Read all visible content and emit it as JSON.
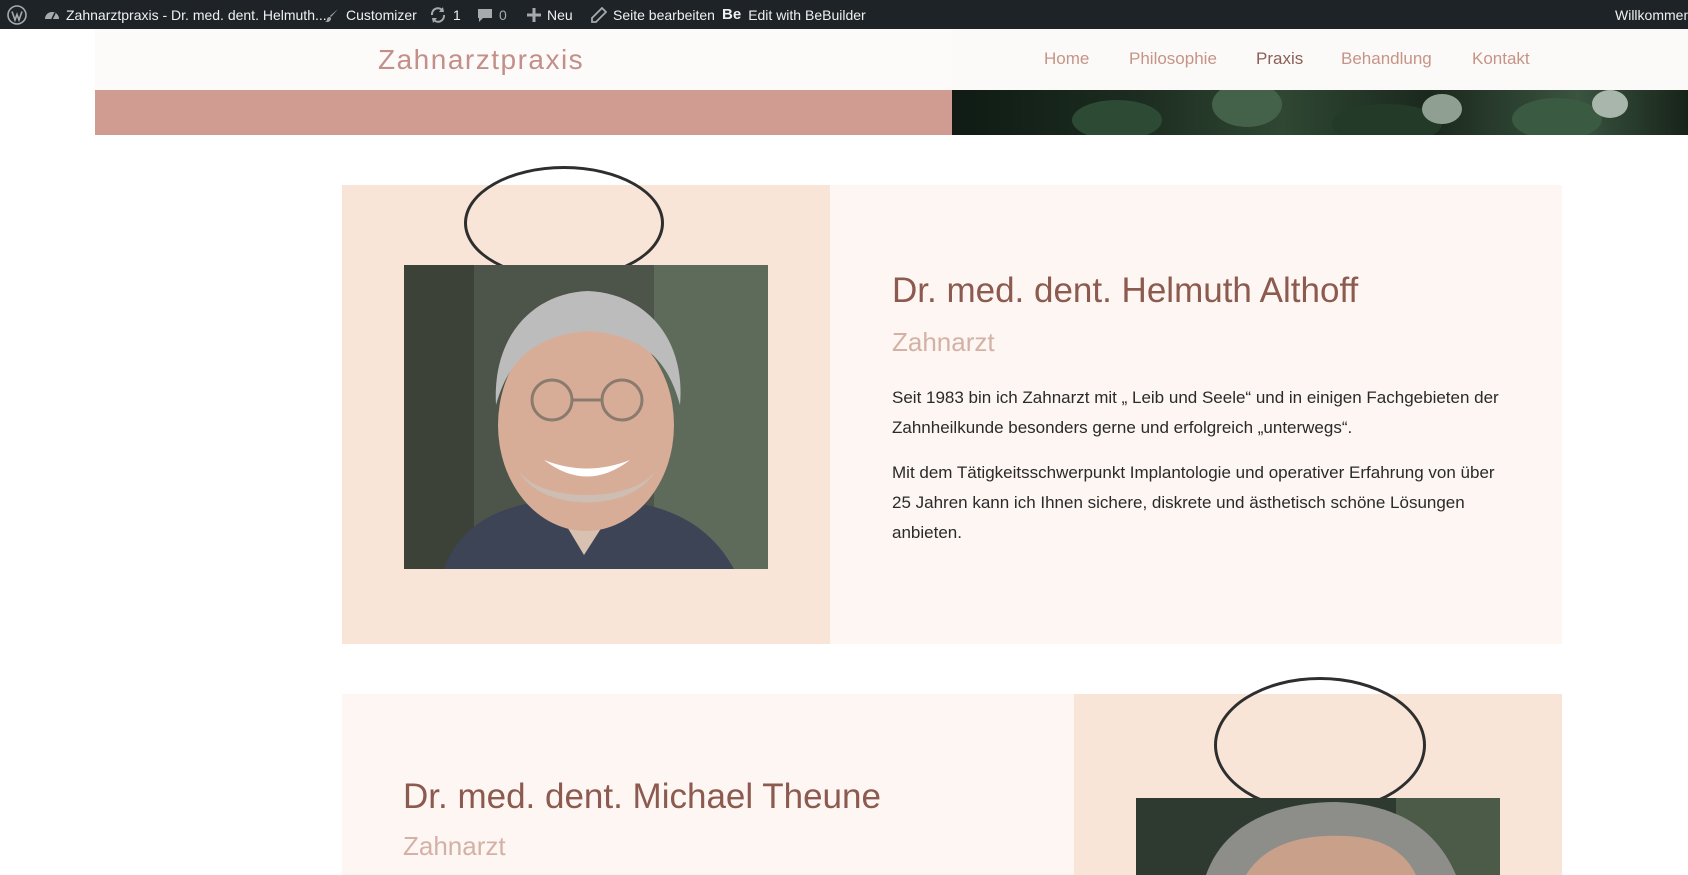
{
  "adminbar": {
    "site_title": "Zahnarztpraxis - Dr. med. dent. Helmuth...",
    "customizer": "Customizer",
    "updates_count": "1",
    "comments_count": "0",
    "new_label": "Neu",
    "edit_page": "Seite bearbeiten",
    "bebuilder_badge": "Be",
    "bebuilder": "Edit with BeBuilder",
    "welcome": "Willkommen"
  },
  "header": {
    "logo": "Zahnarztpraxis",
    "nav": [
      "Home",
      "Philosophie",
      "Praxis",
      "Behandlung",
      "Kontakt"
    ],
    "active_nav": "Praxis"
  },
  "dentists": [
    {
      "name": "Dr. med. dent. Helmuth Althoff",
      "role": "Zahnarzt",
      "paragraphs": [
        "Seit 1983 bin ich Zahnarzt mit „ Leib und Seele“ und in einigen Fachgebieten der Zahnheilkunde besonders gerne und erfolgreich „unterwegs“.",
        "Mit dem Tätigkeitsschwerpunkt Implantologie und operativer Erfahrung von über 25 Jahren kann ich Ihnen sichere, diskrete und ästhetisch schöne Lösungen anbieten."
      ]
    },
    {
      "name": "Dr. med. dent. Michael Theune",
      "role": "Zahnarzt"
    }
  ],
  "colors": {
    "adminbar_bg": "#1d2327",
    "brand_pink": "#d09b91",
    "name_brown": "#8c5a4e",
    "role_pink": "#d4b1a6",
    "panel_peach": "#f9e5d8",
    "panel_cream": "#fdf6f2"
  },
  "icons": {
    "wordpress": "wordpress-logo-icon",
    "customizer": "paintbrush-icon",
    "updates": "refresh-icon",
    "comments": "comment-bubble-icon",
    "new": "plus-icon",
    "edit": "pencil-icon"
  }
}
